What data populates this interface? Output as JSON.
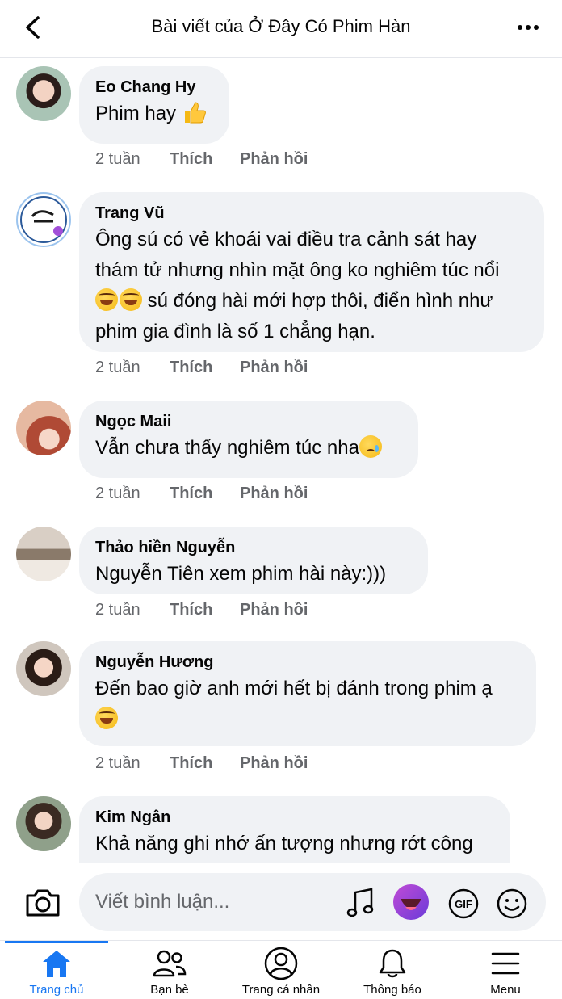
{
  "header": {
    "title": "Bài viết của Ở Đây Có Phim Hàn"
  },
  "comments": [
    {
      "name": "Eo Chang Hy",
      "text": "Phim hay",
      "time": "2 tuần",
      "like": "Thích",
      "reply": "Phản hồi"
    },
    {
      "name": "Trang Vũ",
      "line1": "Ông sú có vẻ khoái vai điều tra cảnh sát hay",
      "line2": "thám tử nhưng nhìn mặt ông ko nghiêm túc nổi",
      "line3": " sú đóng hài mới hợp thôi, điển hình như",
      "line4": "phim gia đình là số 1 chẳng hạn.",
      "time": "2 tuần",
      "like": "Thích",
      "reply": "Phản hồi"
    },
    {
      "name": "Ngọc Maii",
      "text": "Vẫn chưa thấy nghiêm túc nha",
      "time": "2 tuần",
      "like": "Thích",
      "reply": "Phản hồi"
    },
    {
      "name": "Thảo hiền Nguyễn",
      "text": "Nguyễn Tiên  xem phim hài này:)))",
      "time": "2 tuần",
      "like": "Thích",
      "reply": "Phản hồi"
    },
    {
      "name": "Nguyễn Hương",
      "text": "Đến bao giờ anh mới hết bị đánh trong phim ạ",
      "time": "2 tuần",
      "like": "Thích",
      "reply": "Phản hồi"
    },
    {
      "name": "Kim Ngân",
      "text": "Khả năng ghi nhớ ấn tượng nhưng rớt công"
    }
  ],
  "composer": {
    "placeholder": "Viết bình luận..."
  },
  "tabs": [
    {
      "label": "Trang chủ",
      "icon": "home-icon",
      "active": true
    },
    {
      "label": "Bạn bè",
      "icon": "friends-icon"
    },
    {
      "label": "Trang cá nhân",
      "icon": "profile-icon"
    },
    {
      "label": "Thông báo",
      "icon": "bell-icon"
    },
    {
      "label": "Menu",
      "icon": "menu-icon"
    }
  ],
  "colors": {
    "accent": "#1877f2",
    "bubble": "#f0f2f5",
    "meta": "#65676b"
  }
}
